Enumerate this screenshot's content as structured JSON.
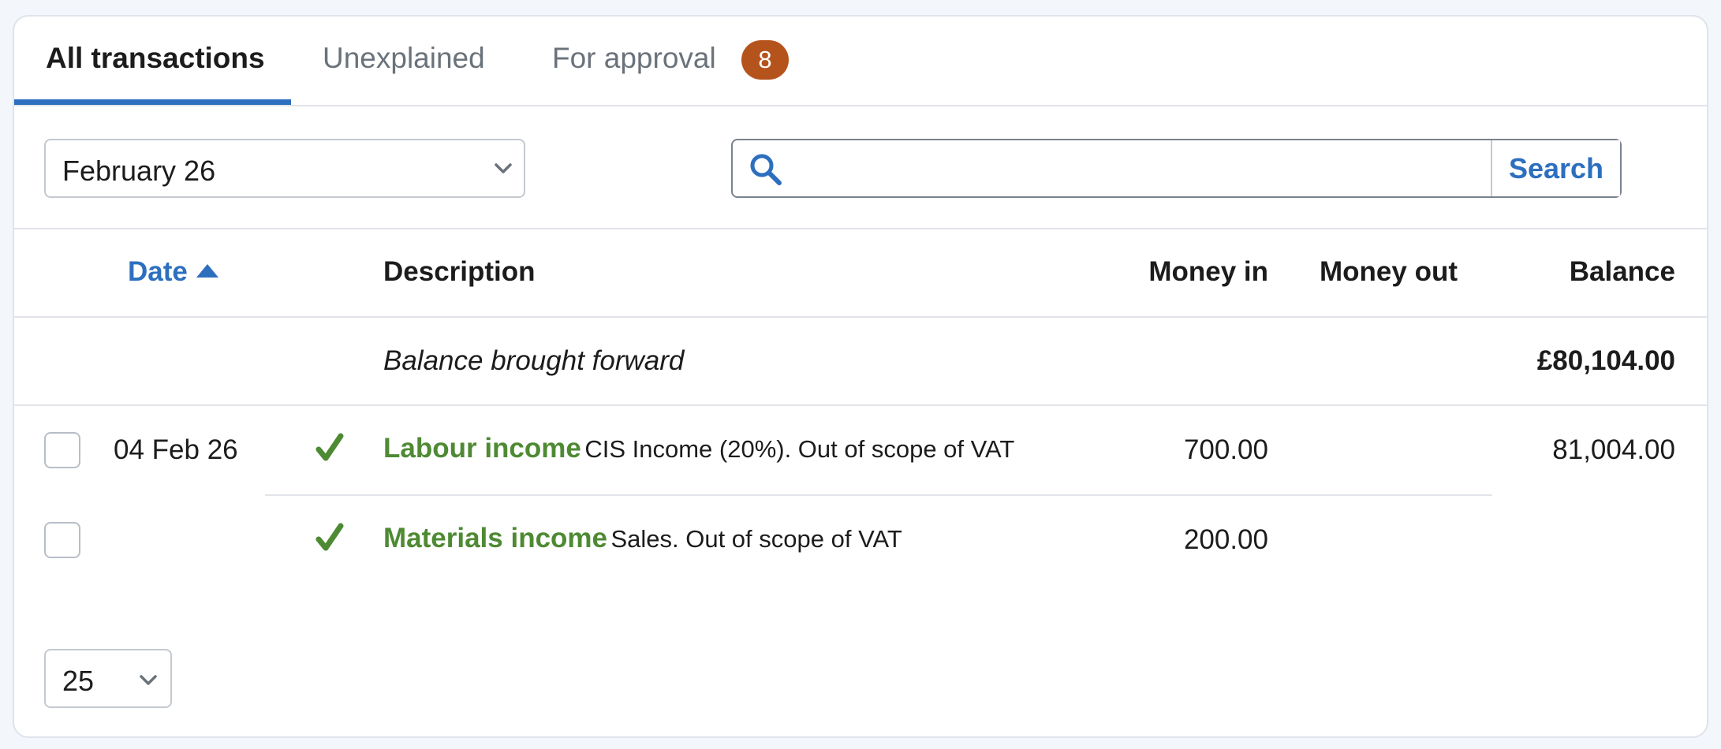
{
  "tabs": [
    {
      "label": "All transactions",
      "active": true
    },
    {
      "label": "Unexplained",
      "active": false
    },
    {
      "label": "For approval",
      "active": false,
      "badge": "8"
    }
  ],
  "filters": {
    "month_selected": "February 26",
    "search_placeholder": "",
    "search_button": "Search"
  },
  "table": {
    "columns": {
      "date": "Date",
      "description": "Description",
      "money_in": "Money in",
      "money_out": "Money out",
      "balance": "Balance"
    },
    "brought_forward": {
      "label": "Balance brought forward",
      "balance": "£80,104.00"
    },
    "rows": [
      {
        "date": "04 Feb 26",
        "category": "Labour income",
        "detail": "CIS Income (20%). Out of scope of VAT",
        "money_in": "700.00",
        "money_out": "",
        "balance": "81,004.00"
      },
      {
        "date": "",
        "category": "Materials income",
        "detail": "Sales. Out of scope of VAT",
        "money_in": "200.00",
        "money_out": "",
        "balance": ""
      }
    ]
  },
  "pager": {
    "per_page": "25"
  },
  "colors": {
    "accent": "#2d6fbf",
    "success": "#4e8a33",
    "badge": "#b5531c"
  },
  "icons": {
    "search": "search-icon",
    "check": "check-icon",
    "dropdown": "chevron-down-icon",
    "sort": "sort-ascending-icon"
  }
}
